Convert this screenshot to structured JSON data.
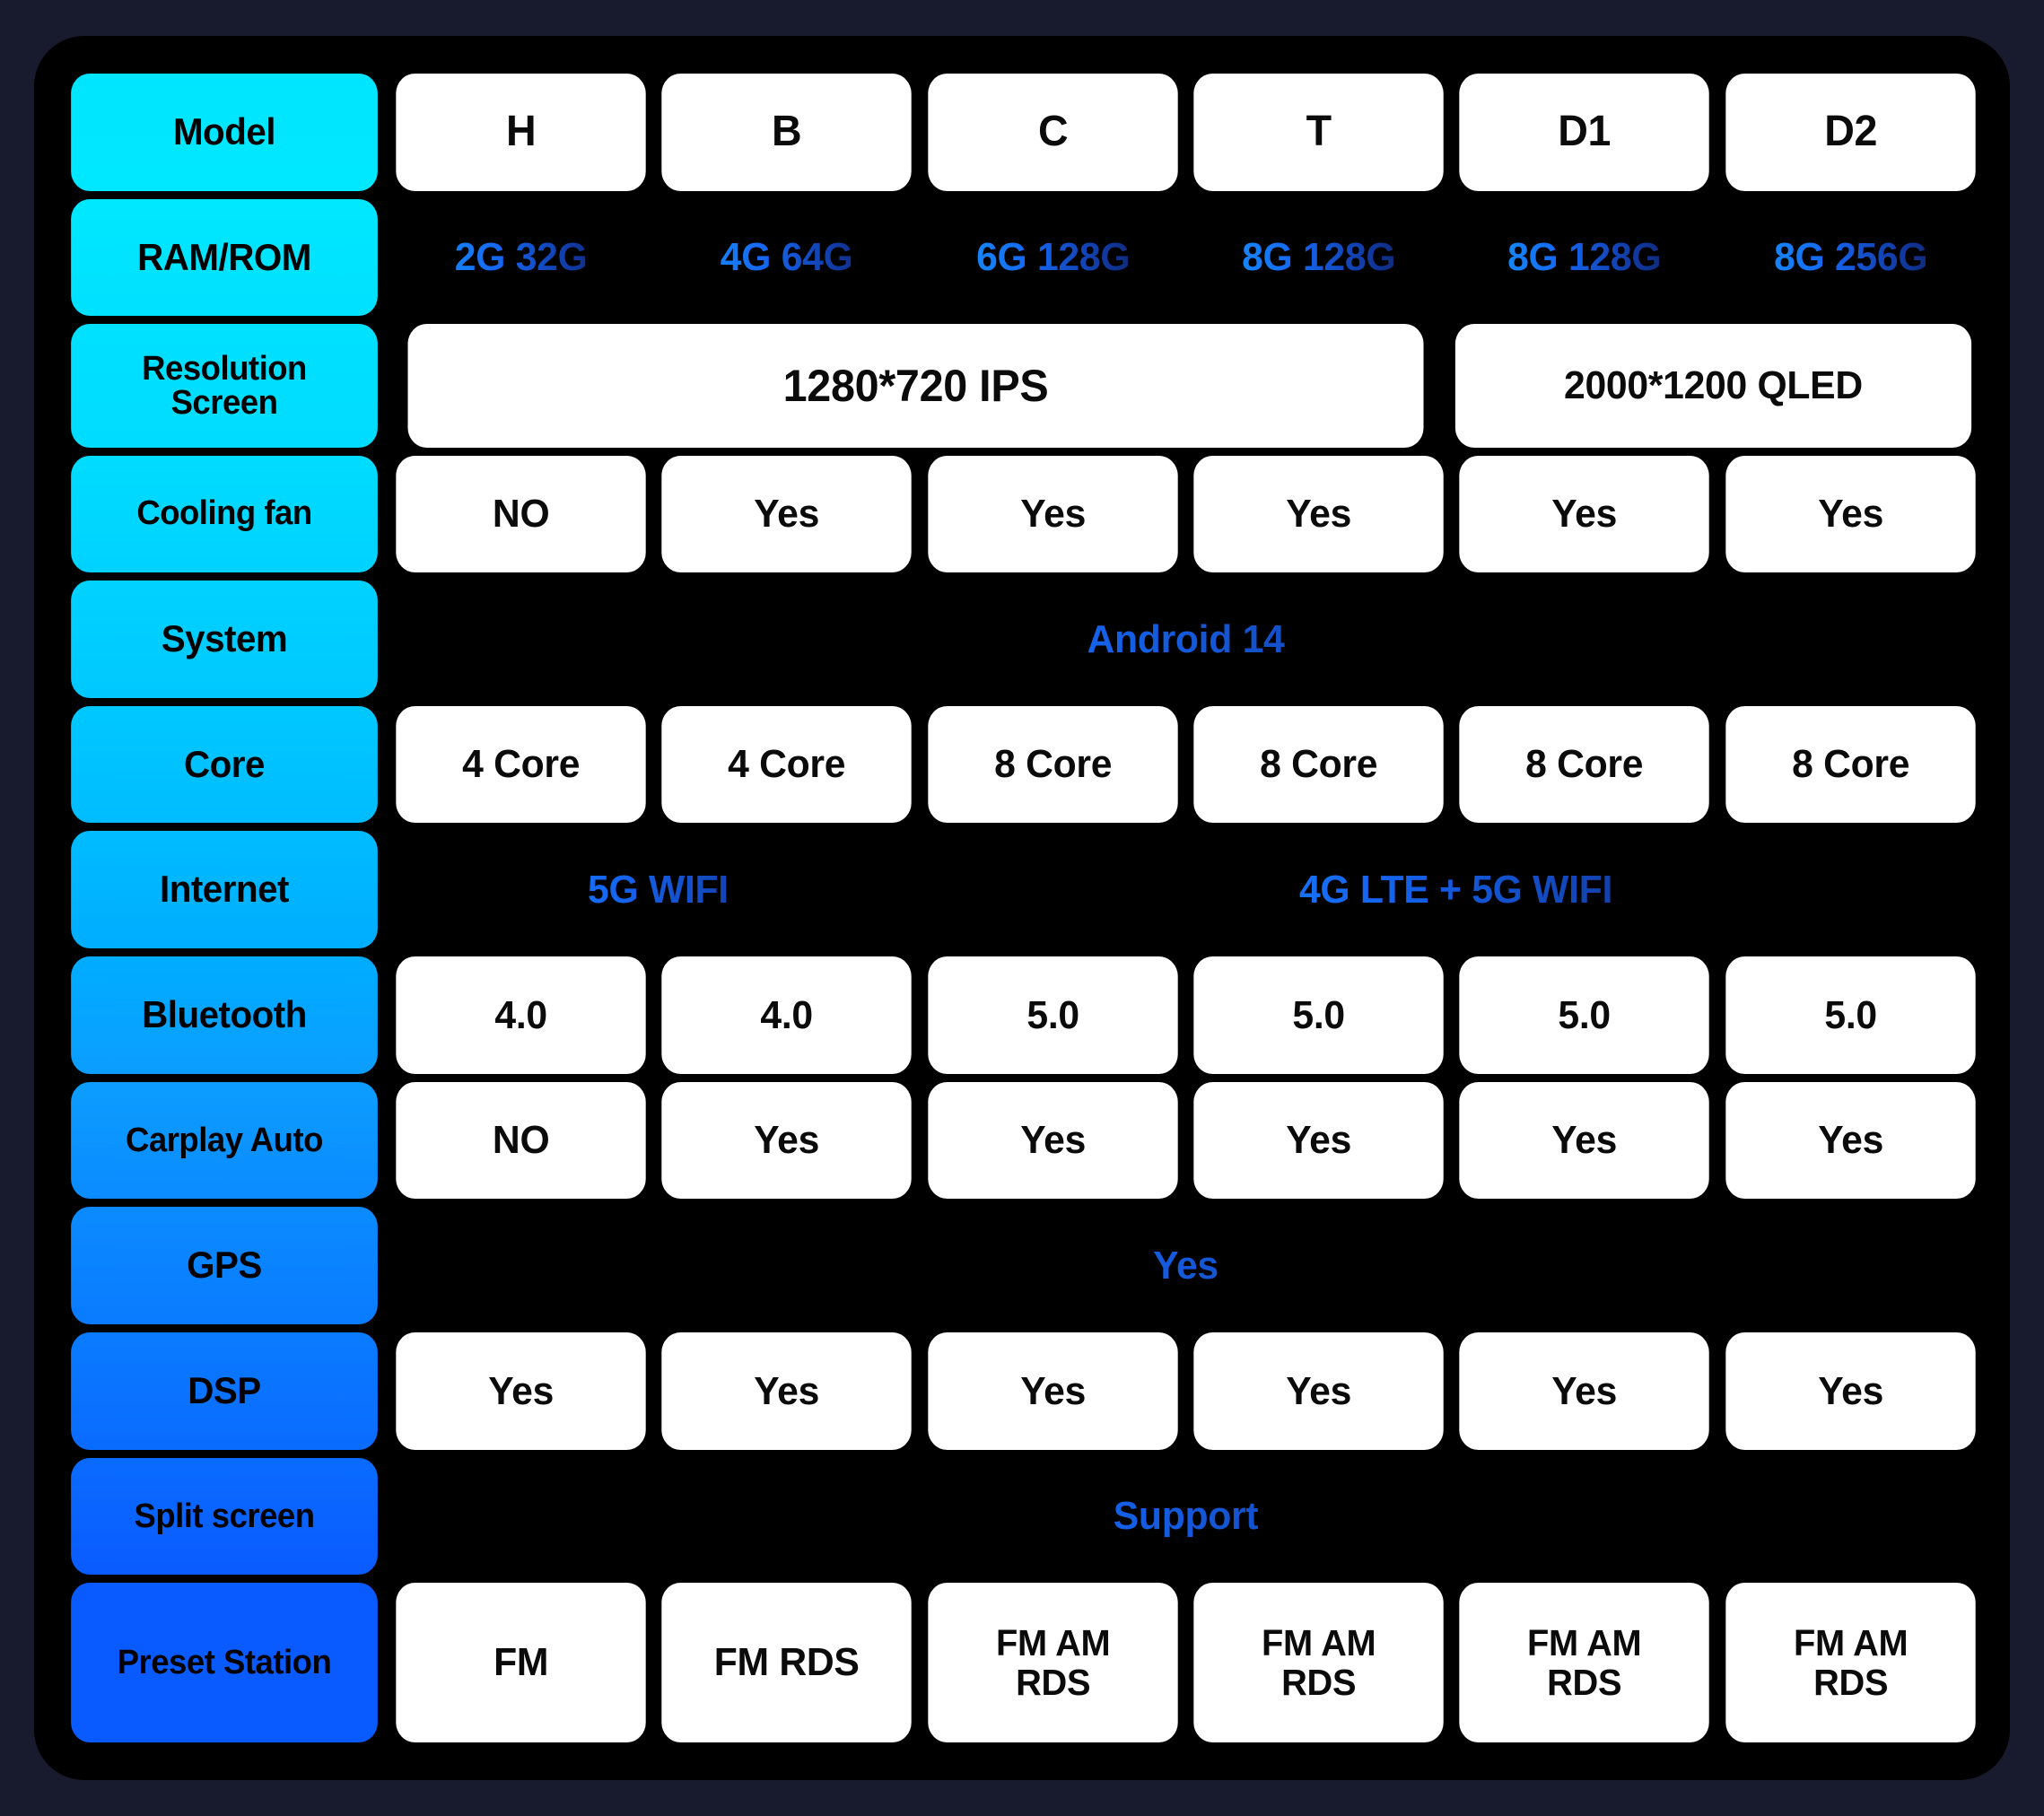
{
  "table": {
    "columns": [
      "H",
      "B",
      "C",
      "T",
      "D1",
      "D2"
    ],
    "rows": [
      {
        "label": "Model",
        "label_color": "#00e5ff",
        "style": "header",
        "cells": [
          {
            "text": "H",
            "span": 1
          },
          {
            "text": "B",
            "span": 1
          },
          {
            "text": "C",
            "span": 1
          },
          {
            "text": "T",
            "span": 1
          },
          {
            "text": "D1",
            "span": 1
          },
          {
            "text": "D2",
            "span": 1
          }
        ]
      },
      {
        "label": "RAM/ROM",
        "label_color": "#00e8ff",
        "style": "gradient",
        "cells": [
          {
            "text": "2G 32G",
            "span": 1
          },
          {
            "text": "4G 64G",
            "span": 1
          },
          {
            "text": "6G 128G",
            "span": 1
          },
          {
            "text": "8G 128G",
            "span": 1
          },
          {
            "text": "8G 128G",
            "span": 1
          },
          {
            "text": "8G 256G",
            "span": 1
          }
        ]
      },
      {
        "label": "Resolution Screen",
        "label_line1": "Resolution",
        "label_line2": "Screen",
        "label_color": "#00e0ff",
        "style": "plain",
        "cells": [
          {
            "text": "1280*720 IPS",
            "span": 4
          },
          {
            "text": "2000*1200 QLED",
            "span": 2
          }
        ]
      },
      {
        "label": "Cooling fan",
        "label_color": "#00dcff",
        "style": "plain",
        "cells": [
          {
            "text": "NO",
            "span": 1
          },
          {
            "text": "Yes",
            "span": 1
          },
          {
            "text": "Yes",
            "span": 1
          },
          {
            "text": "Yes",
            "span": 1
          },
          {
            "text": "Yes",
            "span": 1
          },
          {
            "text": "Yes",
            "span": 1
          }
        ]
      },
      {
        "label": "System",
        "label_color": "#00d2ff",
        "style": "gradient",
        "cells": [
          {
            "text": "Android 14",
            "span": 6
          }
        ]
      },
      {
        "label": "Core",
        "label_color": "#00c8ff",
        "style": "plain",
        "cells": [
          {
            "text": "4 Core",
            "span": 1
          },
          {
            "text": "4 Core",
            "span": 1
          },
          {
            "text": "8 Core",
            "span": 1
          },
          {
            "text": "8 Core",
            "span": 1
          },
          {
            "text": "8 Core",
            "span": 1
          },
          {
            "text": "8 Core",
            "span": 1
          }
        ]
      },
      {
        "label": "Internet",
        "label_color": "#00bcff",
        "style": "gradient",
        "cells": [
          {
            "text": "5G WIFI",
            "span": 2
          },
          {
            "text": "4G LTE + 5G WIFI",
            "span": 4
          }
        ]
      },
      {
        "label": "Bluetooth",
        "label_color": "#00adff",
        "style": "plain",
        "cells": [
          {
            "text": "4.0",
            "span": 1
          },
          {
            "text": "4.0",
            "span": 1
          },
          {
            "text": "5.0",
            "span": 1
          },
          {
            "text": "5.0",
            "span": 1
          },
          {
            "text": "5.0",
            "span": 1
          },
          {
            "text": "5.0",
            "span": 1
          }
        ]
      },
      {
        "label": "Carplay Auto",
        "label_color": "#0c9dff",
        "style": "plain",
        "cells": [
          {
            "text": "NO",
            "span": 1
          },
          {
            "text": "Yes",
            "span": 1
          },
          {
            "text": "Yes",
            "span": 1
          },
          {
            "text": "Yes",
            "span": 1
          },
          {
            "text": "Yes",
            "span": 1
          },
          {
            "text": "Yes",
            "span": 1
          }
        ]
      },
      {
        "label": "GPS",
        "label_color": "#0b8bff",
        "style": "gradient",
        "cells": [
          {
            "text": "Yes",
            "span": 6
          }
        ]
      },
      {
        "label": "DSP",
        "label_color": "#0a7bff",
        "style": "plain",
        "cells": [
          {
            "text": "Yes",
            "span": 1
          },
          {
            "text": "Yes",
            "span": 1
          },
          {
            "text": "Yes",
            "span": 1
          },
          {
            "text": "Yes",
            "span": 1
          },
          {
            "text": "Yes",
            "span": 1
          },
          {
            "text": "Yes",
            "span": 1
          }
        ]
      },
      {
        "label": "Split screen",
        "label_color": "#0a6bff",
        "style": "gradient",
        "cells": [
          {
            "text": "Support",
            "span": 6
          }
        ]
      },
      {
        "label": "Preset Station",
        "label_color": "#0a5bff",
        "style": "plain",
        "cells": [
          {
            "text": "FM",
            "span": 1
          },
          {
            "text": "FM RDS",
            "span": 1
          },
          {
            "text": "FM AM\nRDS",
            "span": 1
          },
          {
            "text": "FM AM\nRDS",
            "span": 1
          },
          {
            "text": "FM AM\nRDS",
            "span": 1
          },
          {
            "text": "FM AM\nRDS",
            "span": 1
          }
        ]
      }
    ]
  },
  "colors": {
    "background": "#181a2d",
    "panel": "#000000",
    "cell_background": "#ffffff",
    "text_dark": "#0b0b0b",
    "gradient_start": "#18a0ff",
    "gradient_end": "#0a1436",
    "label_top": "#00e5ff",
    "label_bottom": "#0a5bff"
  }
}
